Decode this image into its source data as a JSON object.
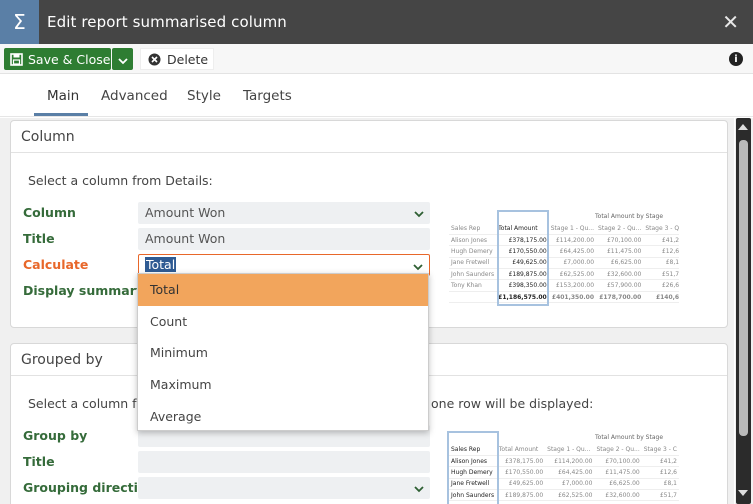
{
  "window": {
    "title": "Edit report summarised column",
    "icon": "sigma-icon"
  },
  "toolbar": {
    "save_label": "Save & Close",
    "delete_label": "Delete"
  },
  "tabs": [
    {
      "label": "Main",
      "active": true
    },
    {
      "label": "Advanced",
      "active": false
    },
    {
      "label": "Style",
      "active": false
    },
    {
      "label": "Targets",
      "active": false
    }
  ],
  "column_panel": {
    "title": "Column",
    "hint": "Select a column from Details:",
    "column_label": "Column",
    "column_value": "Amount Won",
    "title_label": "Title",
    "title_value": "Amount Won",
    "calculate_label": "Calculate",
    "calculate_value": "Total",
    "display_summary_label": "Display summary"
  },
  "dropdown": {
    "options": [
      "Total",
      "Count",
      "Minimum",
      "Maximum",
      "Average"
    ],
    "highlighted": "Total"
  },
  "grouped_panel": {
    "title": "Grouped by",
    "hint_start": "Select a column fr",
    "hint_end": "one row will be displayed:",
    "group_by_label": "Group by",
    "title_label": "Title",
    "grouping_direction_label": "Grouping direction"
  },
  "preview1": {
    "super_header": "Total Amount by Stage",
    "headers": [
      "Sales Rep",
      "Total Amount",
      "Stage 1 - Qu...",
      "Stage 2 - Qu...",
      "Stage 3 - Q"
    ],
    "rows": [
      [
        "Alison Jones",
        "£378,175.00",
        "£114,200.00",
        "£70,100.00",
        "£41,2"
      ],
      [
        "Hugh Demery",
        "£170,550.00",
        "£64,425.00",
        "£11,475.00",
        "£12,6"
      ],
      [
        "Jane Fretwell",
        "£49,625.00",
        "£7,000.00",
        "£6,625.00",
        "£8,1"
      ],
      [
        "John Saunders",
        "£189,875.00",
        "£62,525.00",
        "£32,600.00",
        "£51,7"
      ],
      [
        "Tony Khan",
        "£398,350.00",
        "£153,200.00",
        "£57,900.00",
        "£26,6"
      ]
    ],
    "totals": [
      "",
      "£1,186,575.00",
      "£401,350.00",
      "£178,700.00",
      "£140,6"
    ]
  },
  "preview2": {
    "super_header": "Total Amount by Stage",
    "headers": [
      "Sales Rep",
      "Total Amount",
      "Stage 1 - Qu...",
      "Stage 2 - Qu...",
      "Stage 3 - C"
    ],
    "rows": [
      [
        "Alison Jones",
        "£378,175.00",
        "£114,200.00",
        "£70,100.00",
        "£41,2"
      ],
      [
        "Hugh Demery",
        "£170,550.00",
        "£64,425.00",
        "£11,475.00",
        "£12,6"
      ],
      [
        "Jane Fretwell",
        "£49,625.00",
        "£7,000.00",
        "£6,625.00",
        "£8,1"
      ],
      [
        "John Saunders",
        "£189,875.00",
        "£62,525.00",
        "£32,600.00",
        "£51,7"
      ]
    ]
  }
}
